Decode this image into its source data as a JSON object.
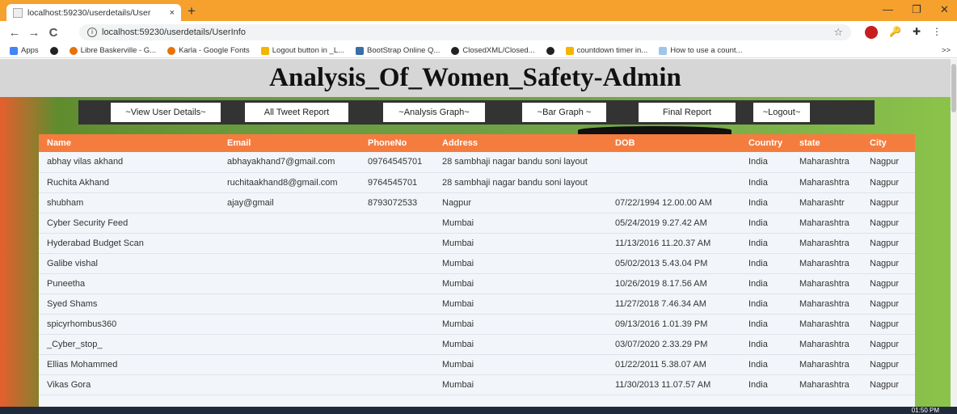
{
  "browser": {
    "tab_title": "localhost:59230/userdetails/User",
    "tab_close": "×",
    "new_tab": "+",
    "back": "←",
    "forward": "→",
    "reload": "C",
    "info": "i",
    "url": "localhost:59230/userdetails/UserInfo",
    "star": "☆",
    "window_minimize": "—",
    "window_maximize": "❐",
    "window_close": "✕",
    "more": ">>"
  },
  "bookmarks": [
    {
      "label": "Apps",
      "color": "#4285f4"
    },
    {
      "label": "",
      "color": "#222222"
    },
    {
      "label": "Libre Baskerville - G...",
      "color": "#e8710a"
    },
    {
      "label": "Karla - Google Fonts",
      "color": "#e8710a"
    },
    {
      "label": "Logout button in _L...",
      "color": "#f4b400"
    },
    {
      "label": "BootStrap Online Q...",
      "color": "#3a6ea5"
    },
    {
      "label": "ClosedXML/Closed...",
      "color": "#222222"
    },
    {
      "label": "",
      "color": "#222222"
    },
    {
      "label": "countdown timer in...",
      "color": "#f4b400"
    },
    {
      "label": "How to use a count...",
      "color": "#9fc5e8"
    }
  ],
  "page": {
    "title": "Analysis_Of_Women_Safety-Admin"
  },
  "nav": [
    {
      "label": "~View User Details~"
    },
    {
      "label": "All Tweet Report"
    },
    {
      "label": "~Analysis Graph~"
    },
    {
      "label": "~Bar Graph ~"
    },
    {
      "label": "Final Report"
    },
    {
      "label": "~Logout~"
    }
  ],
  "table": {
    "columns": [
      "Name",
      "Email",
      "PhoneNo",
      "Address",
      "DOB",
      "Country",
      "state",
      "City"
    ],
    "rows": [
      [
        "abhay vilas akhand",
        "abhayakhand7@gmail.com",
        "09764545701",
        "28 sambhaji nagar bandu soni layout",
        "",
        "India",
        "Maharashtra",
        "Nagpur"
      ],
      [
        "Ruchita Akhand",
        "ruchitaakhand8@gmail.com",
        "9764545701",
        "28 sambhaji nagar bandu soni layout",
        "",
        "India",
        "Maharashtra",
        "Nagpur"
      ],
      [
        "shubham",
        "ajay@gmail",
        "8793072533",
        "Nagpur",
        "07/22/1994 12.00.00 AM",
        "India",
        "Maharashtr",
        "Nagpur"
      ],
      [
        "Cyber Security Feed",
        "",
        "",
        "Mumbai",
        "05/24/2019 9.27.42 AM",
        "India",
        "Maharashtra",
        "Nagpur"
      ],
      [
        "Hyderabad Budget Scan",
        "",
        "",
        "Mumbai",
        "11/13/2016 11.20.37 AM",
        "India",
        "Maharashtra",
        "Nagpur"
      ],
      [
        "Galibe vishal",
        "",
        "",
        "Mumbai",
        "05/02/2013 5.43.04 PM",
        "India",
        "Maharashtra",
        "Nagpur"
      ],
      [
        "Puneetha",
        "",
        "",
        "Mumbai",
        "10/26/2019 8.17.56 AM",
        "India",
        "Maharashtra",
        "Nagpur"
      ],
      [
        "Syed Shams",
        "",
        "",
        "Mumbai",
        "11/27/2018 7.46.34 AM",
        "India",
        "Maharashtra",
        "Nagpur"
      ],
      [
        "spicyrhombus360",
        "",
        "",
        "Mumbai",
        "09/13/2016 1.01.39 PM",
        "India",
        "Maharashtra",
        "Nagpur"
      ],
      [
        "_Cyber_stop_",
        "",
        "",
        "Mumbai",
        "03/07/2020 2.33.29 PM",
        "India",
        "Maharashtra",
        "Nagpur"
      ],
      [
        "Ellias Mohammed",
        "",
        "",
        "Mumbai",
        "01/22/2011 5.38.07 AM",
        "India",
        "Maharashtra",
        "Nagpur"
      ],
      [
        "Vikas Gora",
        "",
        "",
        "Mumbai",
        "11/30/2013 11.07.57 AM",
        "India",
        "Maharashtra",
        "Nagpur"
      ]
    ]
  },
  "taskbar": {
    "clock": "01:50 PM"
  },
  "colors": {
    "table_header": "#f57c3f",
    "tab_strip": "#f6a02e",
    "navbar": "#333333"
  }
}
